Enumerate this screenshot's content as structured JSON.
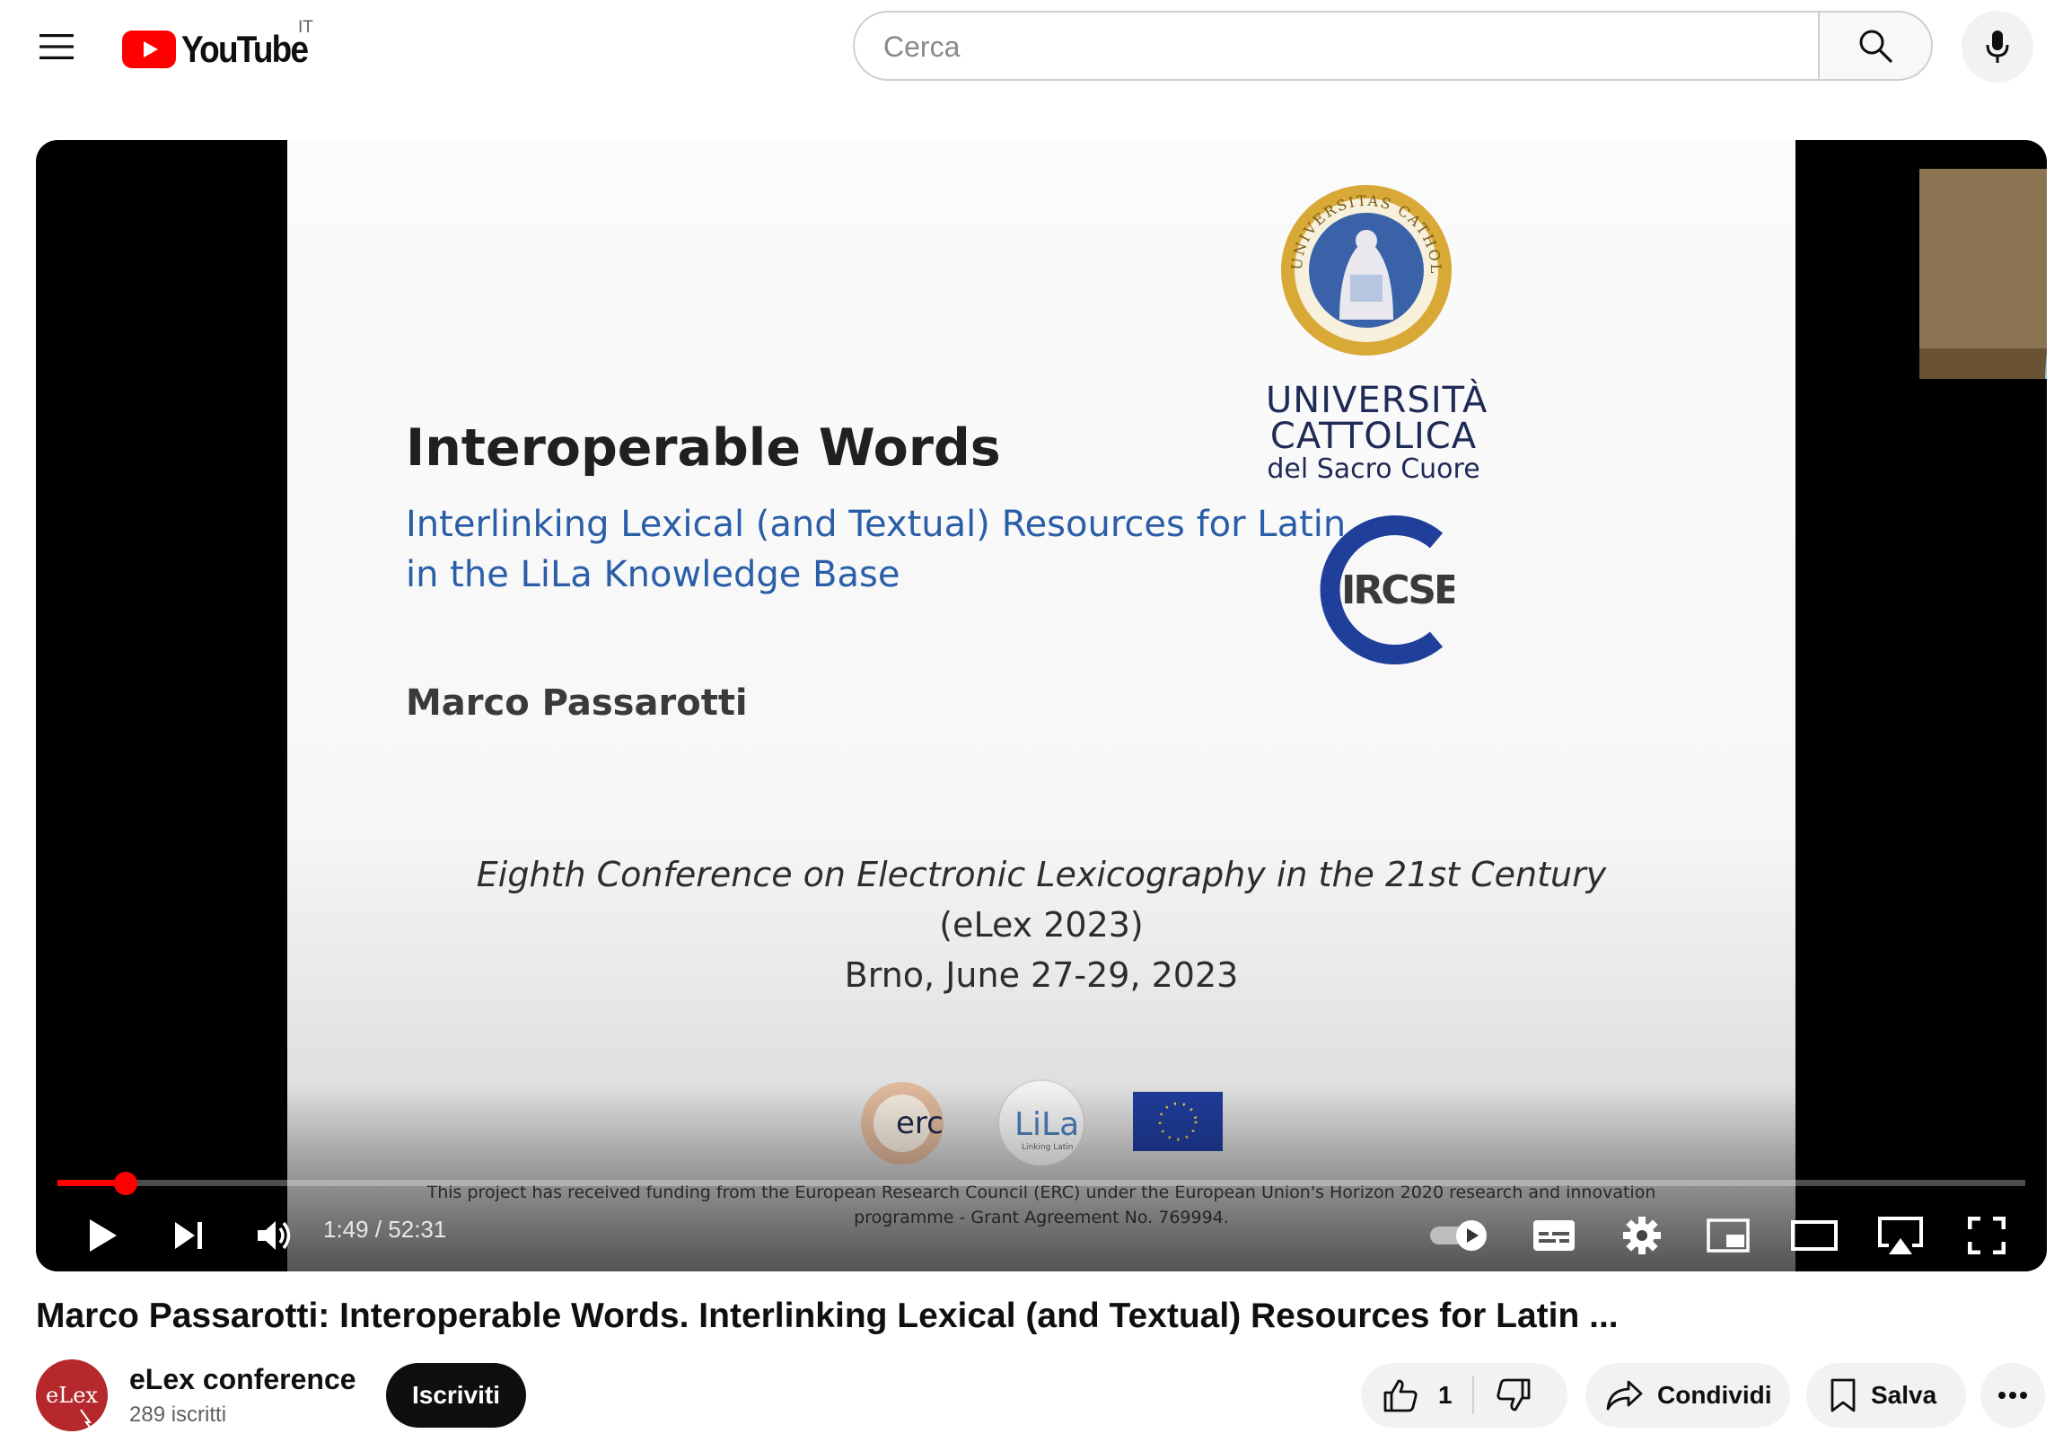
{
  "masthead": {
    "logo_text": "YouTube",
    "country_code": "IT",
    "search": {
      "placeholder": "Cerca",
      "value": ""
    },
    "icons": [
      "menu-icon",
      "search-icon",
      "mic-icon"
    ]
  },
  "player": {
    "slide": {
      "title": "Interoperable Words",
      "subtitle_line1": "Interlinking Lexical (and Textual) Resources for Latin",
      "subtitle_line2": "in the LiLa Knowledge Base",
      "author": "Marco Passarotti",
      "conference_line1": "Eighth Conference on Electronic Lexicography in the 21st Century",
      "conference_line2": "(eLex 2023)",
      "conference_line3": "Brno, June 27-29, 2023",
      "funding_line1": "This project has received funding from the European Research Council (ERC) under the European Union's Horizon 2020 research and innovation",
      "funding_line2": "programme - Grant Agreement No. 769994.",
      "university_line1": "UNIVERSITÀ",
      "university_line2": "CATTOLICA",
      "university_line3": "del Sacro Cuore",
      "seal_text": "UNIVERSITAS CATHOLICA MEDIOLANI",
      "ircse_logo_text": "IRCSE",
      "erc_logo_text": "erc",
      "lila_logo_text": "LiLa",
      "lila_logo_tagline": "Linking Latin"
    },
    "progress": {
      "played_fraction": 0.0348
    },
    "time_current": "1:49",
    "time_total": "52:31",
    "time_display": "1:49 / 52:31",
    "autoplay_on": true,
    "controls": [
      "play-icon",
      "next-icon",
      "volume-icon",
      "autoplay-toggle",
      "subtitles-icon",
      "settings-icon",
      "miniplayer-icon",
      "theater-mode-icon",
      "airplay-icon",
      "fullscreen-icon"
    ]
  },
  "video": {
    "title": "Marco Passarotti: Interoperable Words. Interlinking Lexical (and Textual) Resources for Latin ..."
  },
  "channel": {
    "avatar_text": "eLex",
    "name": "eLex conference",
    "subscribers": "289 iscritti",
    "subscribe_label": "Iscriviti"
  },
  "actions": {
    "like_count": "1",
    "share_label": "Condividi",
    "save_label": "Salva"
  },
  "colors": {
    "brand_red": "#ff0000",
    "subtitle_blue": "#2a5ea8",
    "button_bg": "#f2f2f2",
    "subscribe_bg": "#0f0f0f"
  }
}
